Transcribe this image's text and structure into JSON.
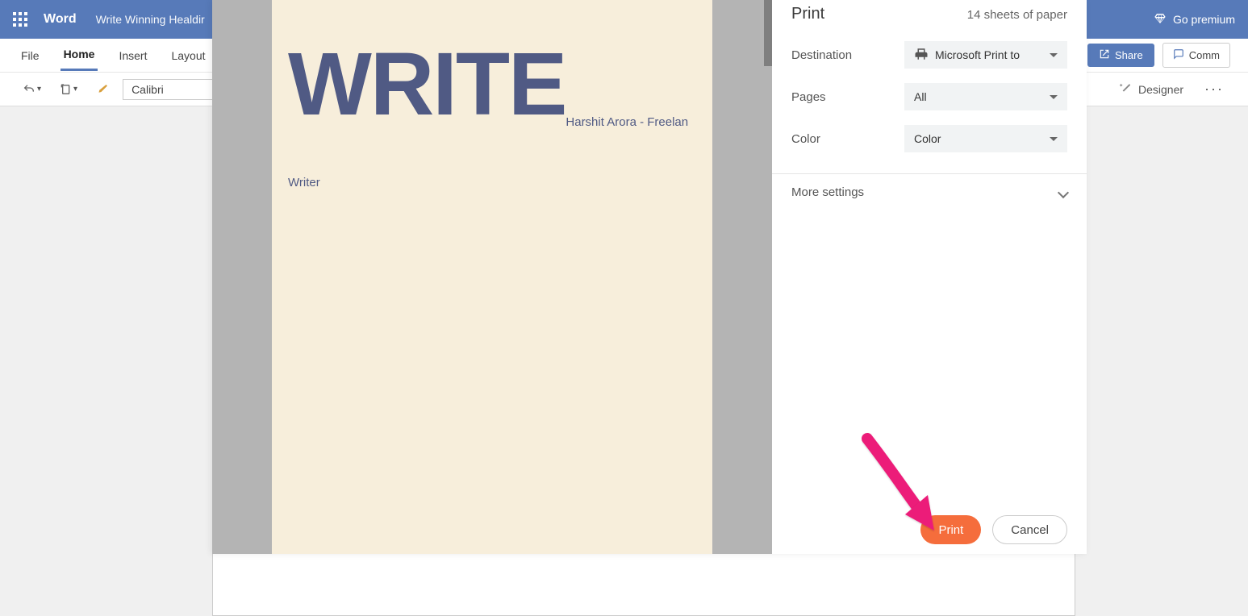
{
  "titlebar": {
    "app": "Word",
    "doc": "Write Winning Healdir",
    "premium": "Go premium"
  },
  "menu": {
    "file": "File",
    "home": "Home",
    "insert": "Insert",
    "layout": "Layout"
  },
  "actions": {
    "share": "Share",
    "comments": "Comm"
  },
  "toolbar": {
    "font": "Calibri",
    "designer": "Designer"
  },
  "preview": {
    "big": "WRITE",
    "sub": "Harshit Arora - Freelan",
    "writer": "Writer"
  },
  "print": {
    "title": "Print",
    "sheets": "14 sheets of paper",
    "destination_label": "Destination",
    "destination_value": "Microsoft Print to",
    "pages_label": "Pages",
    "pages_value": "All",
    "color_label": "Color",
    "color_value": "Color",
    "more": "More settings",
    "print_btn": "Print",
    "cancel_btn": "Cancel"
  }
}
